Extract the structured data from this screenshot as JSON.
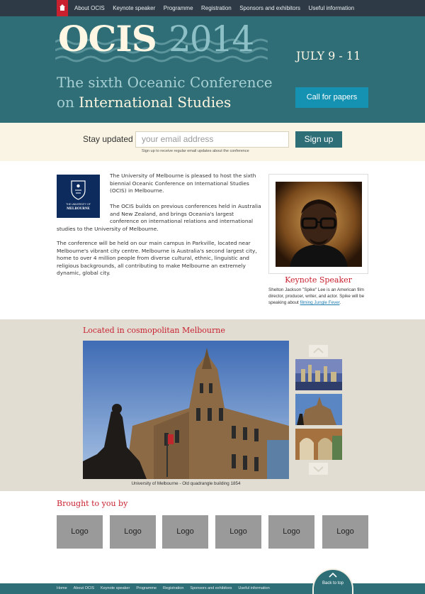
{
  "nav": {
    "items": [
      "About OCIS",
      "Keynote speaker",
      "Programme",
      "Registration",
      "Sponsors and exhibitors",
      "Useful information"
    ]
  },
  "hero": {
    "logo_main": "OCIS",
    "logo_year": "2014",
    "dates": "JULY 9 - 11",
    "subtitle_line1": "The sixth Oceanic Conference",
    "subtitle_on": "on",
    "subtitle_line2": "International Studies",
    "cta_label": "Call for papers"
  },
  "newsletter": {
    "label": "Stay updated",
    "placeholder": "your email address",
    "button": "Sign up",
    "hint": "Sign up to receive regular email updates about the conference"
  },
  "university_logo": {
    "line1": "THE UNIVERSITY OF",
    "line2": "MELBOURNE"
  },
  "intro": {
    "p1": "The University of Melbourne is pleased to host the sixth biennial Oceanic Conference on International Studies (OCIS) in Melbourne.",
    "p2": "The OCIS builds on previous conferences held in Australia and New Zealand, and brings Oceania's largest conference on international relations and international",
    "p2_end": "studies to the University of Melbourne.",
    "p3": "The conference will be held on our main campus in Parkville, located near Melbourne's vibrant city centre. Melbourne is Australia's second largest city, home to over 4 million people from diverse cultural, ethnic, linguistic and religious backgrounds, all contributing to make Melbourne an extremely dynamic, global city."
  },
  "keynote": {
    "title": "Keynote Speaker",
    "desc": "Shelton Jackson \"Spike\" Lee is an American film director, producer, writer, and actor. Spike will be speaking about",
    "link": "filming Jungle Fever",
    "desc_end": "."
  },
  "gallery": {
    "title": "Located in cosmopolitan Melbourne",
    "caption": "University of Melbourne - Old quadrangle building 1854"
  },
  "sponsors": {
    "title": "Brought to you by",
    "logos": [
      "Logo",
      "Logo",
      "Logo",
      "Logo",
      "Logo",
      "Logo"
    ]
  },
  "footer": {
    "links": [
      "Home",
      "About OCIS",
      "Keynote speaker",
      "Programme",
      "Registration",
      "Sponsors and exhibitors",
      "Useful information"
    ],
    "back_to_top": "Back to top"
  },
  "colors": {
    "nav_bg": "#2e3b46",
    "brand_teal": "#2f6e77",
    "accent_red": "#c8202f",
    "cta_blue": "#1592b2",
    "cream": "#f9f4e3",
    "gallery_bg": "#e1ddd3"
  }
}
